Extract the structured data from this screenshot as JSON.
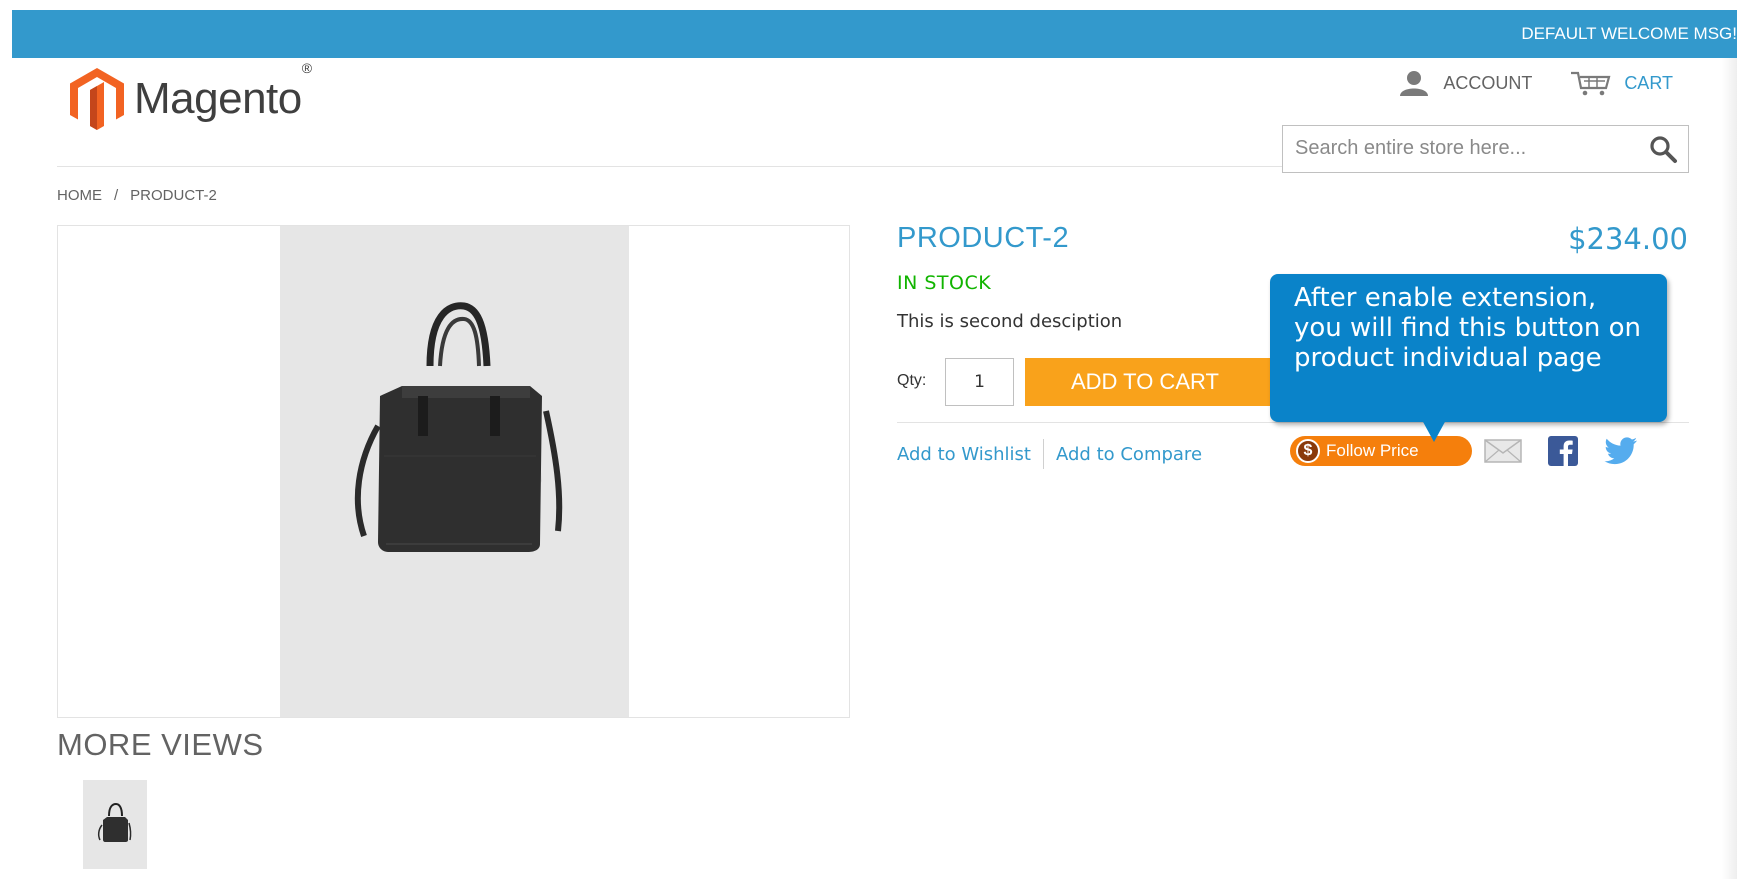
{
  "topbar": {
    "welcome": "DEFAULT WELCOME MSG!",
    "bg_color": "#3399cc"
  },
  "header": {
    "logo_text": "Magento",
    "logo_reg": "®",
    "account_label": "ACCOUNT",
    "cart_label": "CART",
    "search_placeholder": "Search entire store here..."
  },
  "breadcrumb": {
    "home": "HOME",
    "separator": "/",
    "current": "PRODUCT-2"
  },
  "gallery": {
    "more_views_title": "MORE VIEWS"
  },
  "product": {
    "name": "PRODUCT-2",
    "price": "$234.00",
    "stock": "IN STOCK",
    "description": "This is second desciption",
    "qty_label": "Qty:",
    "qty_value": "1",
    "add_to_cart": "ADD TO CART",
    "add_to_wishlist": "Add to Wishlist",
    "add_to_compare": "Add to Compare",
    "follow_price": "Follow Price",
    "follow_price_symbol": "$"
  },
  "callout": {
    "text": "After enable extension, you will find this button on product individual page"
  },
  "colors": {
    "accent_blue": "#3399cc",
    "cart_orange": "#f9a21b",
    "stock_green": "#11b400",
    "follow_price_orange": "#f57f0c",
    "callout_blue": "#0a83c9"
  },
  "icons": {
    "account": "person-icon",
    "cart": "cart-icon",
    "search": "magnifier-icon",
    "email": "envelope-icon",
    "facebook": "facebook-icon",
    "twitter": "twitter-bird-icon"
  }
}
